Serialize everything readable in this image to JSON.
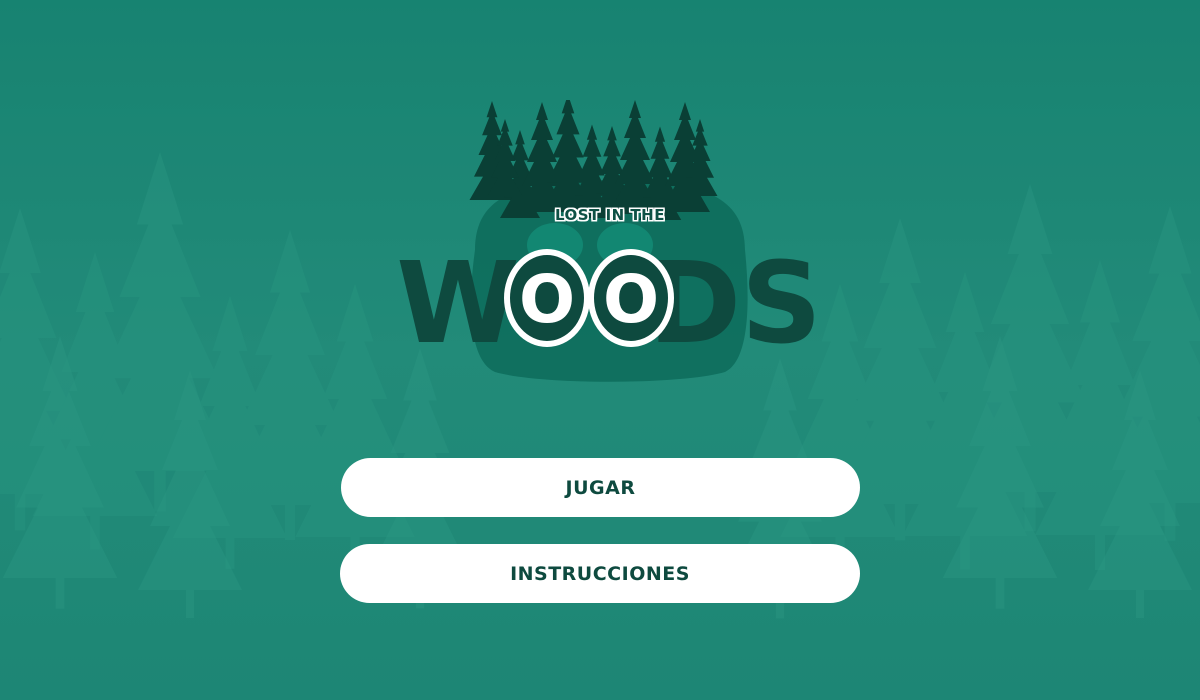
{
  "game": {
    "title_top": "LOST IN THE",
    "title_main_left": "W",
    "title_main_o1": "O",
    "title_main_o2": "O",
    "title_main_right": "DS"
  },
  "menu": {
    "play_label": "JUGAR",
    "instructions_label": "INSTRUCCIONES"
  },
  "colors": {
    "background": "#1f8a78",
    "logo_dark": "#0e4a3f",
    "button_bg": "#ffffff",
    "button_text": "#0e4a3f"
  }
}
